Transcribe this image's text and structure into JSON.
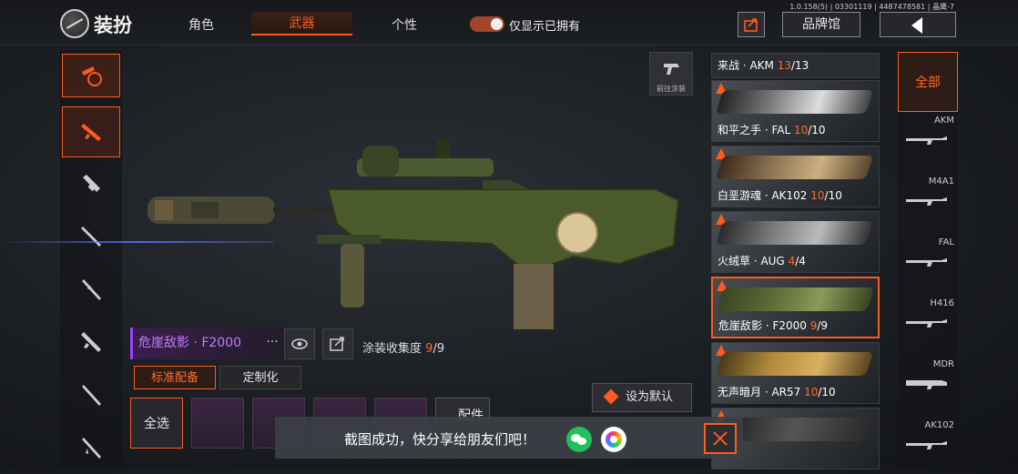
{
  "header": {
    "title": "装扮",
    "tabs": [
      "角色",
      "武器",
      "个性"
    ],
    "active_tab": "武器",
    "toggle_label": "仅显示已拥有",
    "version": "1.0.158(5) | 03301119 | 4487478581 | 晶鹰-7",
    "brand_button": "品牌馆"
  },
  "preview": {
    "button_label": "前往涂装"
  },
  "weapon": {
    "name": "危崖敌影 · F2000",
    "more": "···",
    "collection_label": "涂装收集度",
    "collected": "9",
    "total": "/9"
  },
  "subtabs": {
    "standard": "标准配备",
    "custom": "定制化"
  },
  "attachments": {
    "select_all": "全选",
    "title": "配件"
  },
  "set_default": "设为默认",
  "skins": [
    {
      "name": "来战 · AKM",
      "owned": "13",
      "total": "/13"
    },
    {
      "name": "和平之手 · FAL",
      "owned": "10",
      "total": "/10"
    },
    {
      "name": "白垩游魂 · AK102",
      "owned": "10",
      "total": "/10"
    },
    {
      "name": "火绒草 · AUG",
      "owned": "4",
      "total": "/4"
    },
    {
      "name": "危崖敌影 · F2000",
      "owned": "9",
      "total": "/9"
    },
    {
      "name": "无声暗月 · AR57",
      "owned": "10",
      "total": "/10"
    }
  ],
  "weapon_types": {
    "all": "全部",
    "items": [
      "AKM",
      "M4A1",
      "FAL",
      "H416",
      "MDR",
      "AK102"
    ]
  },
  "toast": {
    "message": "截图成功，快分享给朋友们吧！"
  },
  "colors": {
    "accent": "#ff5a1f",
    "epic": "#a040ff",
    "laser": "#5a6eff"
  }
}
